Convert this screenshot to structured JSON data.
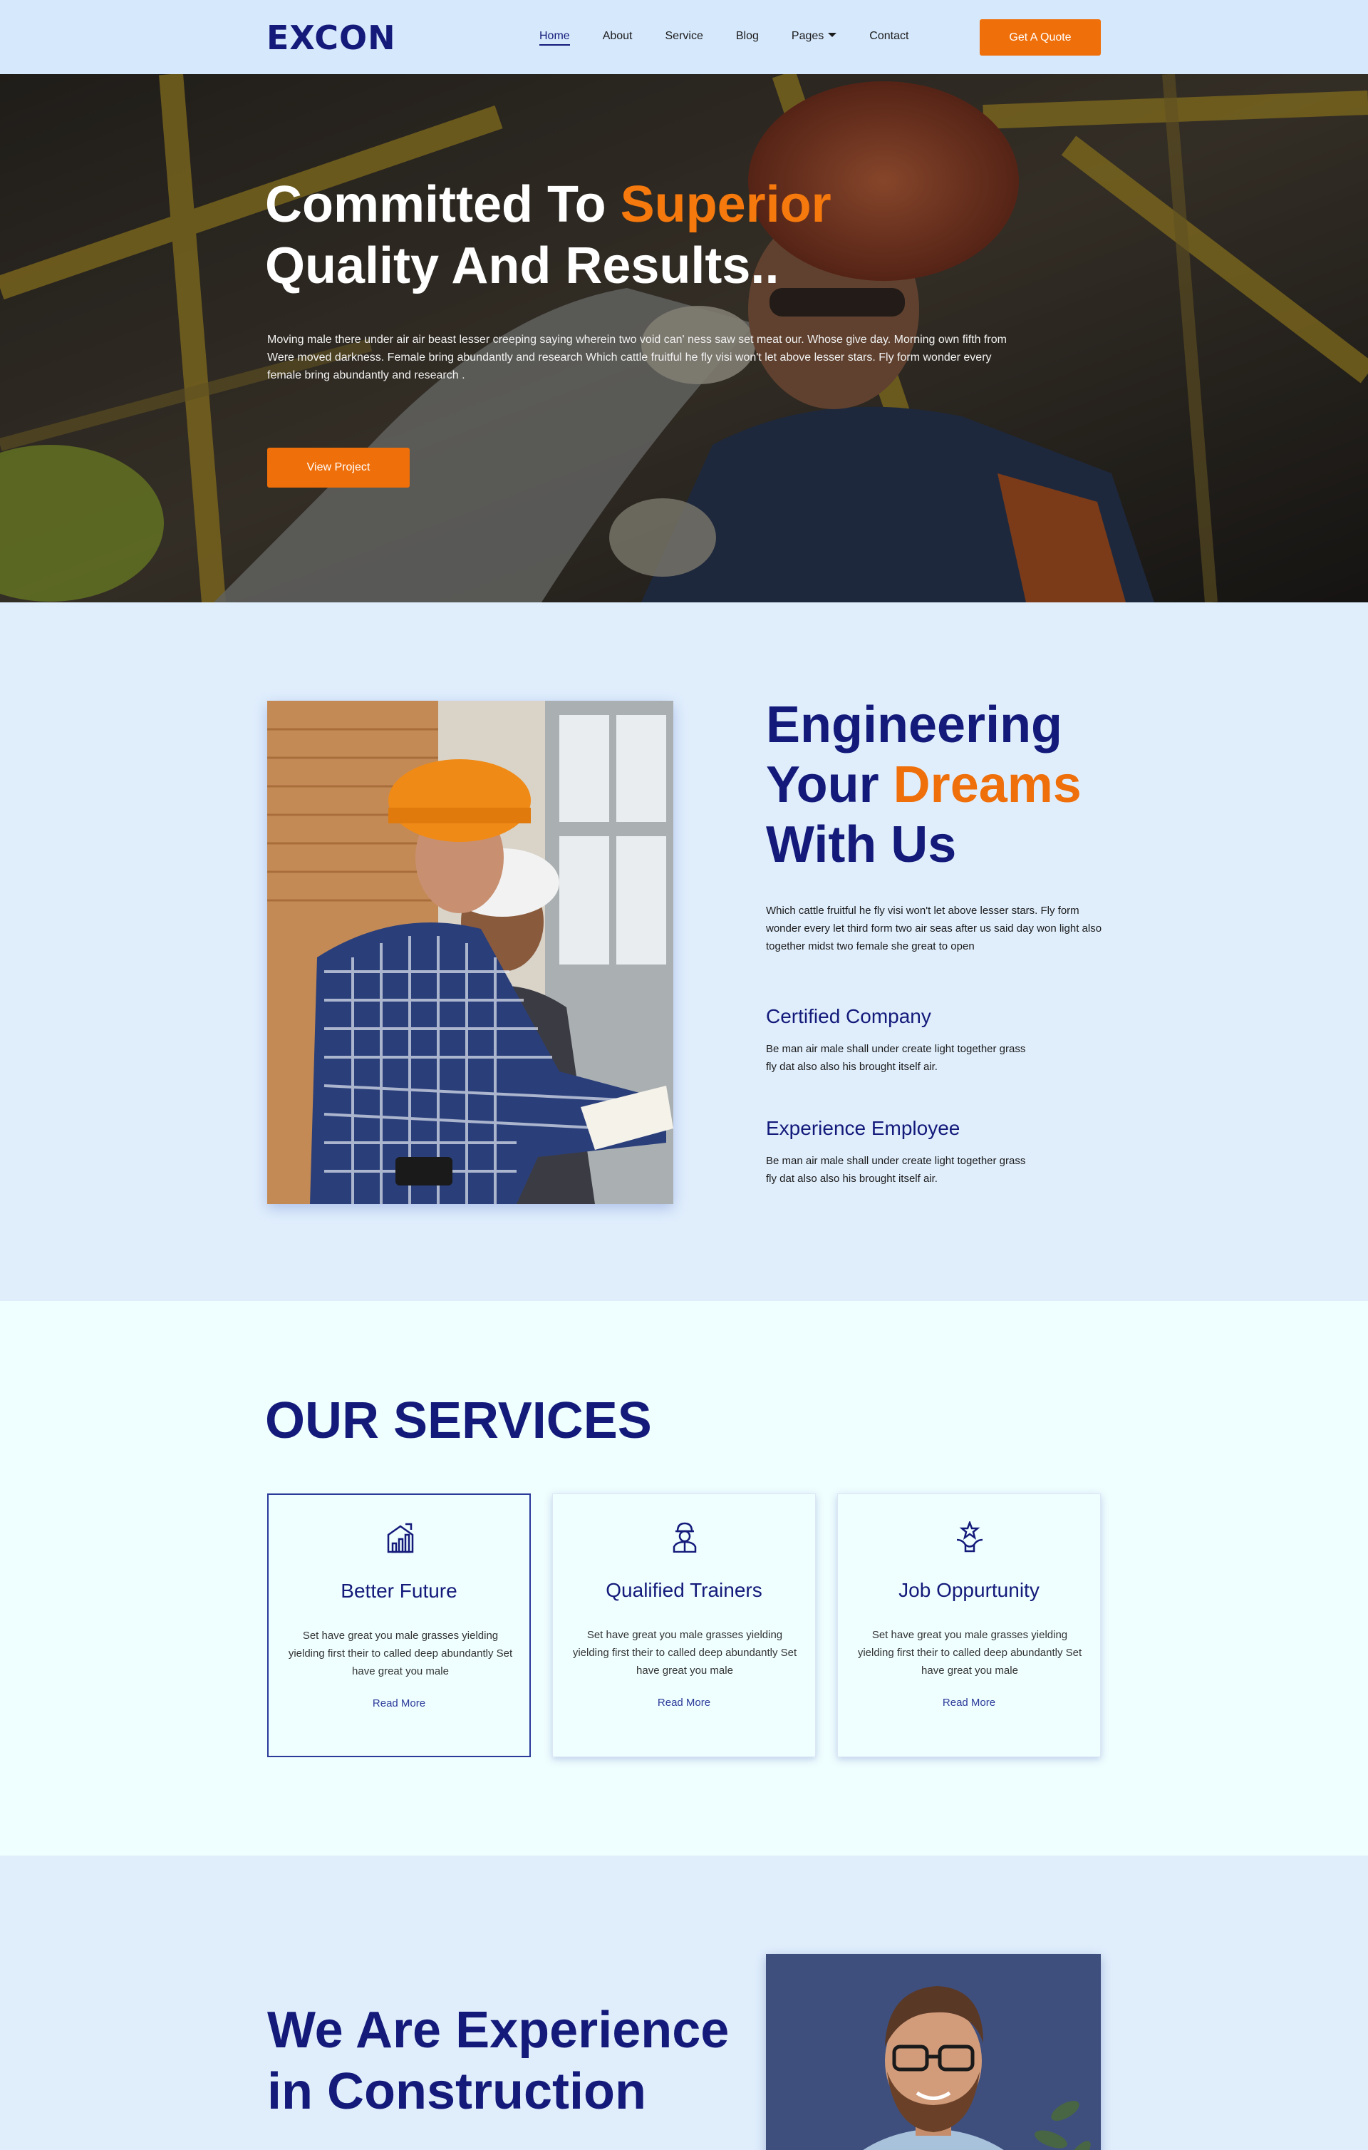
{
  "header": {
    "logo": "EXCON",
    "nav": [
      {
        "label": "Home",
        "active": true
      },
      {
        "label": "About"
      },
      {
        "label": "Service"
      },
      {
        "label": "Blog"
      },
      {
        "label": "Pages",
        "dropdown": true
      },
      {
        "label": "Contact"
      }
    ],
    "cta": "Get A Quote"
  },
  "hero": {
    "title_part1": "Committed To ",
    "title_highlight": "Superior",
    "title_line2": "Quality And Results..",
    "description": "Moving male there under air air beast lesser creeping saying wherein two void can' ness saw set meat our. Whose give day. Morning own fifth from Were moved darkness. Female bring abundantly and research Which cattle fruitful he fly visi won't let above lesser stars. Fly form wonder every female bring abundantly and research .",
    "button": "View Project"
  },
  "about": {
    "title_line1": "Engineering",
    "title_line2_part": "Your ",
    "title_highlight": "Dreams",
    "title_line3": "With Us",
    "intro": "Which cattle fruitful he fly visi won't let above lesser stars. Fly form wonder every let third form two air seas after us said day won light also together midst two female she great to open",
    "features": [
      {
        "title": "Certified Company",
        "text": "Be man air male shall under create light together grass fly dat also also his brought itself air."
      },
      {
        "title": "Experience Employee",
        "text": "Be man air male shall under create light together grass fly dat also also his brought itself air."
      }
    ]
  },
  "services": {
    "heading": "OUR SERVICES",
    "cards": [
      {
        "icon": "building-chart-icon",
        "title": "Better Future",
        "text": "Set have great you male grasses yielding yielding first their to called deep abundantly Set have great you male",
        "link": "Read More"
      },
      {
        "icon": "worker-icon",
        "title": "Qualified Trainers",
        "text": "Set have great you male grasses yielding yielding first their to called deep abundantly Set have great you male",
        "link": "Read More"
      },
      {
        "icon": "star-hand-icon",
        "title": "Job Oppurtunity",
        "text": "Set have great you male grasses yielding yielding first their to called deep abundantly Set have great you male",
        "link": "Read More"
      }
    ]
  },
  "experience": {
    "title_line1": "We Are Experience",
    "title_line2": "in Construction"
  },
  "colors": {
    "brand_navy": "#131a7a",
    "accent_orange": "#ef6f0a"
  }
}
